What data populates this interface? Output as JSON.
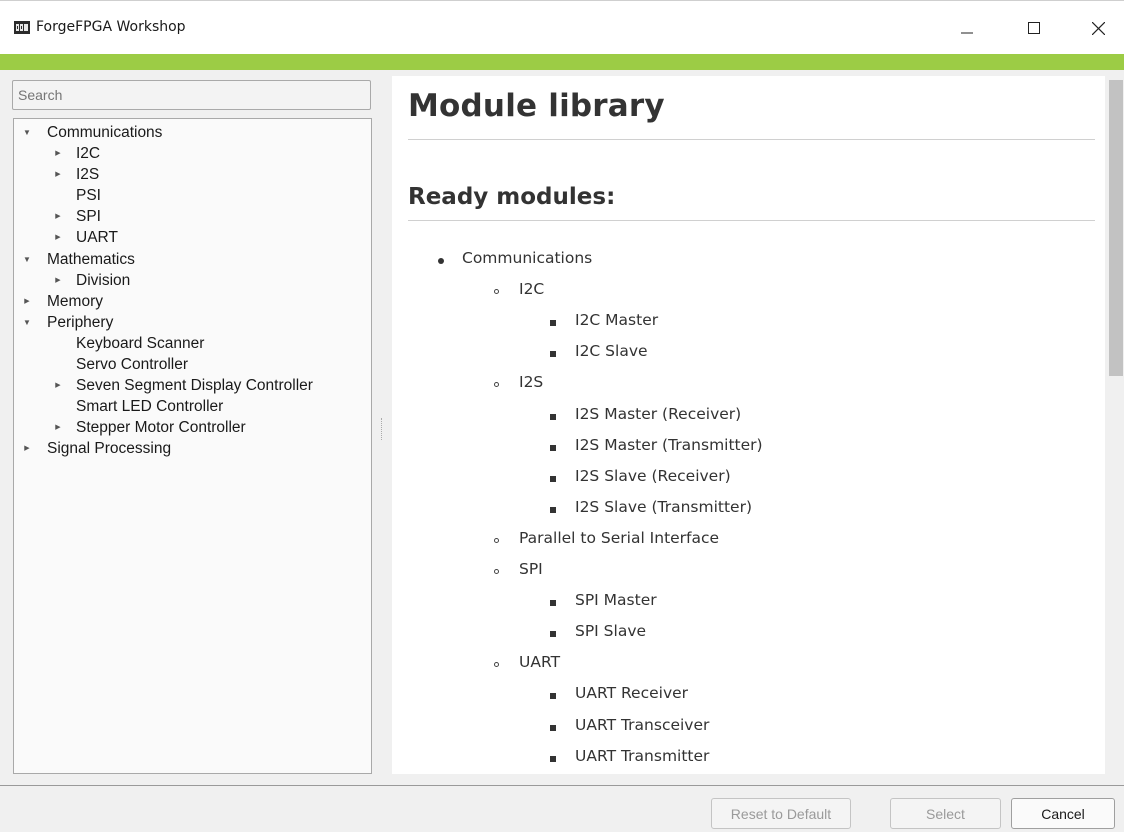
{
  "window": {
    "title": "ForgeFPGA Workshop",
    "accent_color": "#9ccc45",
    "controls": [
      "minimize-icon",
      "maximize-icon",
      "close-icon"
    ]
  },
  "search": {
    "placeholder": "Search"
  },
  "tree": {
    "items": [
      {
        "label": "Communications",
        "expander": "expanded",
        "level": 0
      },
      {
        "label": "I2C",
        "expander": "collapsed",
        "level": 1
      },
      {
        "label": "I2S",
        "expander": "collapsed",
        "level": 1
      },
      {
        "label": "PSI",
        "expander": "none",
        "level": 1
      },
      {
        "label": "SPI",
        "expander": "collapsed",
        "level": 1
      },
      {
        "label": "UART",
        "expander": "collapsed",
        "level": 1
      },
      {
        "label": "Mathematics",
        "expander": "expanded",
        "level": 0
      },
      {
        "label": "Division",
        "expander": "collapsed",
        "level": 1
      },
      {
        "label": "Memory",
        "expander": "collapsed",
        "level": 0
      },
      {
        "label": "Periphery",
        "expander": "expanded",
        "level": 0
      },
      {
        "label": "Keyboard Scanner",
        "expander": "none",
        "level": 2
      },
      {
        "label": "Servo Controller",
        "expander": "none",
        "level": 2
      },
      {
        "label": "Seven Segment Display Controller",
        "expander": "collapsed",
        "level": 1
      },
      {
        "label": "Smart LED Controller",
        "expander": "none",
        "level": 2
      },
      {
        "label": "Stepper Motor Controller",
        "expander": "collapsed",
        "level": 1
      },
      {
        "label": "Signal Processing",
        "expander": "collapsed",
        "level": 0
      }
    ]
  },
  "content": {
    "title": "Module library",
    "subtitle": "Ready modules:",
    "list": [
      {
        "text": "Communications",
        "level": 1
      },
      {
        "text": "I2C",
        "level": 2
      },
      {
        "text": "I2C Master",
        "level": 3
      },
      {
        "text": "I2C Slave",
        "level": 3
      },
      {
        "text": "I2S",
        "level": 2
      },
      {
        "text": "I2S Master (Receiver)",
        "level": 3
      },
      {
        "text": "I2S Master (Transmitter)",
        "level": 3
      },
      {
        "text": "I2S Slave (Receiver)",
        "level": 3
      },
      {
        "text": "I2S Slave (Transmitter)",
        "level": 3
      },
      {
        "text": "Parallel to Serial Interface",
        "level": 2
      },
      {
        "text": "SPI",
        "level": 2
      },
      {
        "text": "SPI Master",
        "level": 3
      },
      {
        "text": "SPI Slave",
        "level": 3
      },
      {
        "text": "UART",
        "level": 2
      },
      {
        "text": "UART Receiver",
        "level": 3
      },
      {
        "text": "UART Transceiver",
        "level": 3
      },
      {
        "text": "UART Transmitter",
        "level": 3
      }
    ]
  },
  "buttons": {
    "reset": "Reset to Default",
    "select": "Select",
    "cancel": "Cancel"
  }
}
